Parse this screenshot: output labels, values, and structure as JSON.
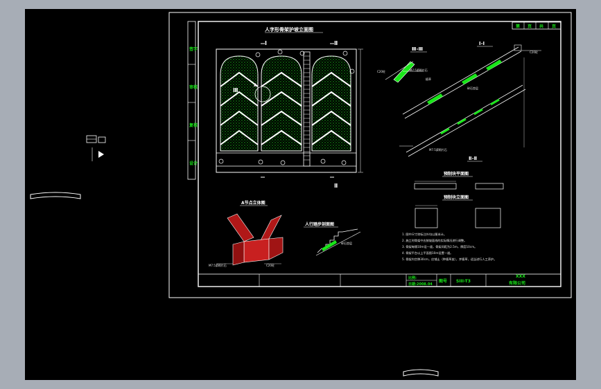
{
  "drawing": {
    "title_main": "人字形骨架护坡立面图",
    "node_a_title": "A节点立体图",
    "path_title": "人行踏步剖面图",
    "section_33": "Ⅲ-Ⅲ",
    "section_11": "Ⅰ-Ⅰ",
    "section_22": "Ⅱ-Ⅱ",
    "precast_plan": "预制块平面图",
    "precast_elev": "预制块立面图",
    "mark_1": "Ⅰ",
    "mark_2": "Ⅱ",
    "mark_3": "Ⅲ",
    "mark_a": "A",
    "header_cells": [
      "第",
      "页",
      "共",
      "页"
    ],
    "side_labels": [
      "签字",
      "审核",
      "复核",
      "设计"
    ],
    "notes": [
      "1.  图中尺寸除标注外均以厘米计。",
      "2.  施工时骨架中应按坡面线的实际情况进行调整。",
      "3.  骨架每隔10m设一道，骨架间距为2.5m，厚度10cm。",
      "4.  骨架平台以上平面图10m设置一道。",
      "5.  骨架内空隙30cm，应铺土（种植草皮），并植草，适当进行人工养护。"
    ],
    "tb_scale": "比例:",
    "tb_date": "日期:2008.04",
    "tb_drawing_no_label": "图号",
    "tb_drawing_no": "SIII-T3",
    "tb_company_top": "XXX",
    "tb_company": "有限公司",
    "dim_ann_1": "C20砼",
    "dim_ann_2": "M7.5浆砌片石",
    "dim_ann_3": "植草",
    "dim_ann_4": "碎石垫层"
  },
  "colors": {
    "viewport_bg": "#000000",
    "frame_bg": "#a7adb6",
    "line": "#ffffff",
    "green": "#19e619",
    "red": "#e02020",
    "cyan": "#33e6e6",
    "yellow": "#e8e84a"
  }
}
